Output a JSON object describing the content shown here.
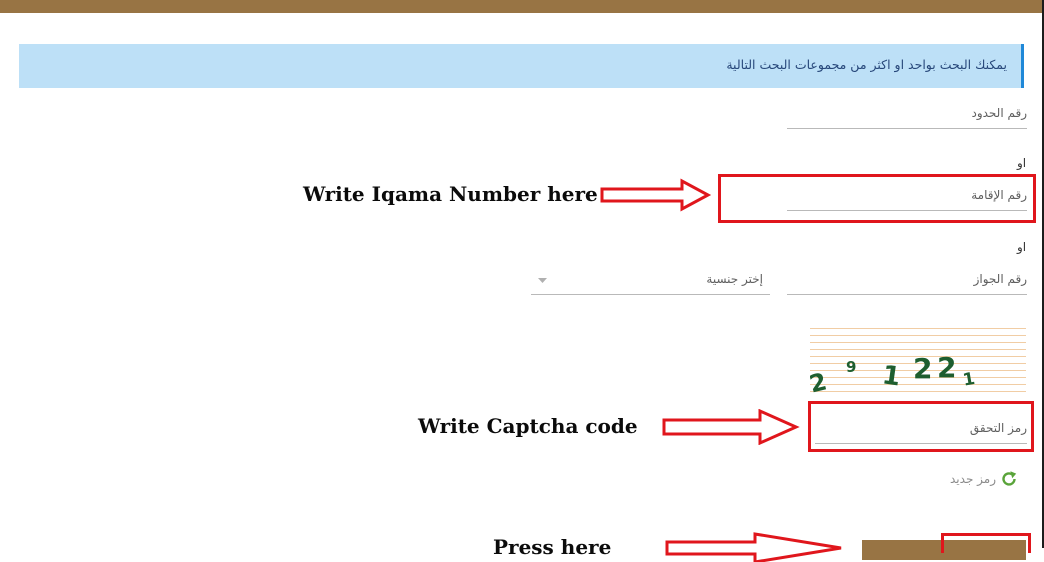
{
  "alert": {
    "text": "يمكنك البحث بواحد او اكثر من مجموعات البحث التالية"
  },
  "fields": {
    "border_number": {
      "placeholder": "رقم الحدود"
    },
    "iqama_number": {
      "placeholder": "رقم الإقامة"
    },
    "passport_number": {
      "placeholder": "رقم الجواز"
    },
    "nationality": {
      "placeholder": "إختر جنسية"
    },
    "captcha_code": {
      "placeholder": "رمز التحقق"
    }
  },
  "or_label": "او",
  "captcha_image": {
    "chars": [
      "2",
      "9",
      "1",
      "2",
      "2",
      "1"
    ]
  },
  "refresh": {
    "label": "رمز جديد",
    "icon": "refresh-icon"
  },
  "annotations": {
    "iqama": "Write Iqama Number here",
    "captcha": "Write Captcha code",
    "press": "Press here"
  },
  "colors": {
    "brand": "#987444",
    "alert_bg": "#bde0f7",
    "annotation_red": "#e0161c",
    "refresh_green": "#5aa43a"
  }
}
